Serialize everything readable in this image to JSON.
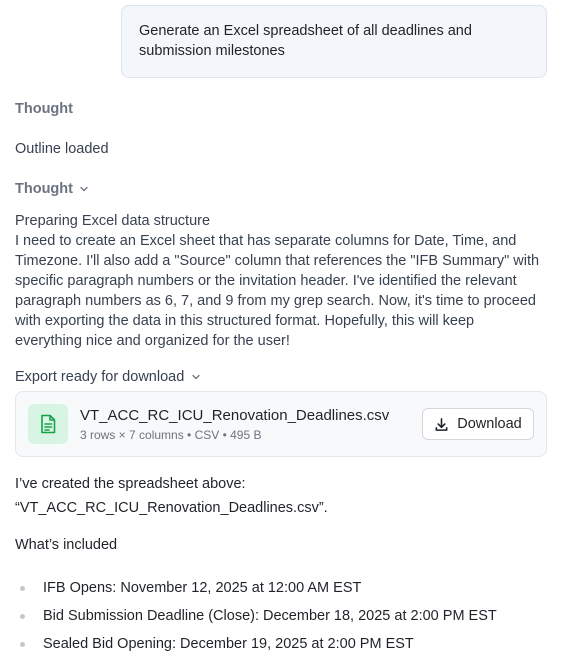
{
  "user_message": "Generate an Excel spreadsheet of all deadlines and submission milestones",
  "thought_1": "Thought",
  "outline_status": "Outline loaded",
  "thought_2": "Thought",
  "thinking": {
    "heading": "Preparing Excel data structure",
    "body": "I need to create an Excel sheet that has separate columns for Date, Time, and Timezone. I'll also add a \"Source\" column that references the \"IFB Summary\" with specific paragraph numbers or the invitation header. I've identified the relevant paragraph numbers as 6, 7, and 9 from my grep search. Now, it's time to proceed with exporting the data in this structured format. Hopefully, this will keep everything nice and organized for the user!"
  },
  "export": {
    "label": "Export ready for download",
    "file_name": "VT_ACC_RC_ICU_Renovation_Deadlines.csv",
    "file_meta": "3 rows × 7 columns • CSV • 495 B",
    "download_label": "Download",
    "icon": "spreadsheet-file-icon",
    "accent_color": "#16a34a"
  },
  "response": {
    "line1": "I’ve created the spreadsheet above:",
    "line2": "“VT_ACC_RC_ICU_Renovation_Deadlines.csv”.",
    "section_title": "What’s included",
    "items": [
      "IFB Opens: November 12, 2025 at 12:00 AM EST",
      "Bid Submission Deadline (Close): December 18, 2025 at 2:00 PM EST",
      "Sealed Bid Opening: December 19, 2025 at 2:00 PM EST"
    ]
  }
}
